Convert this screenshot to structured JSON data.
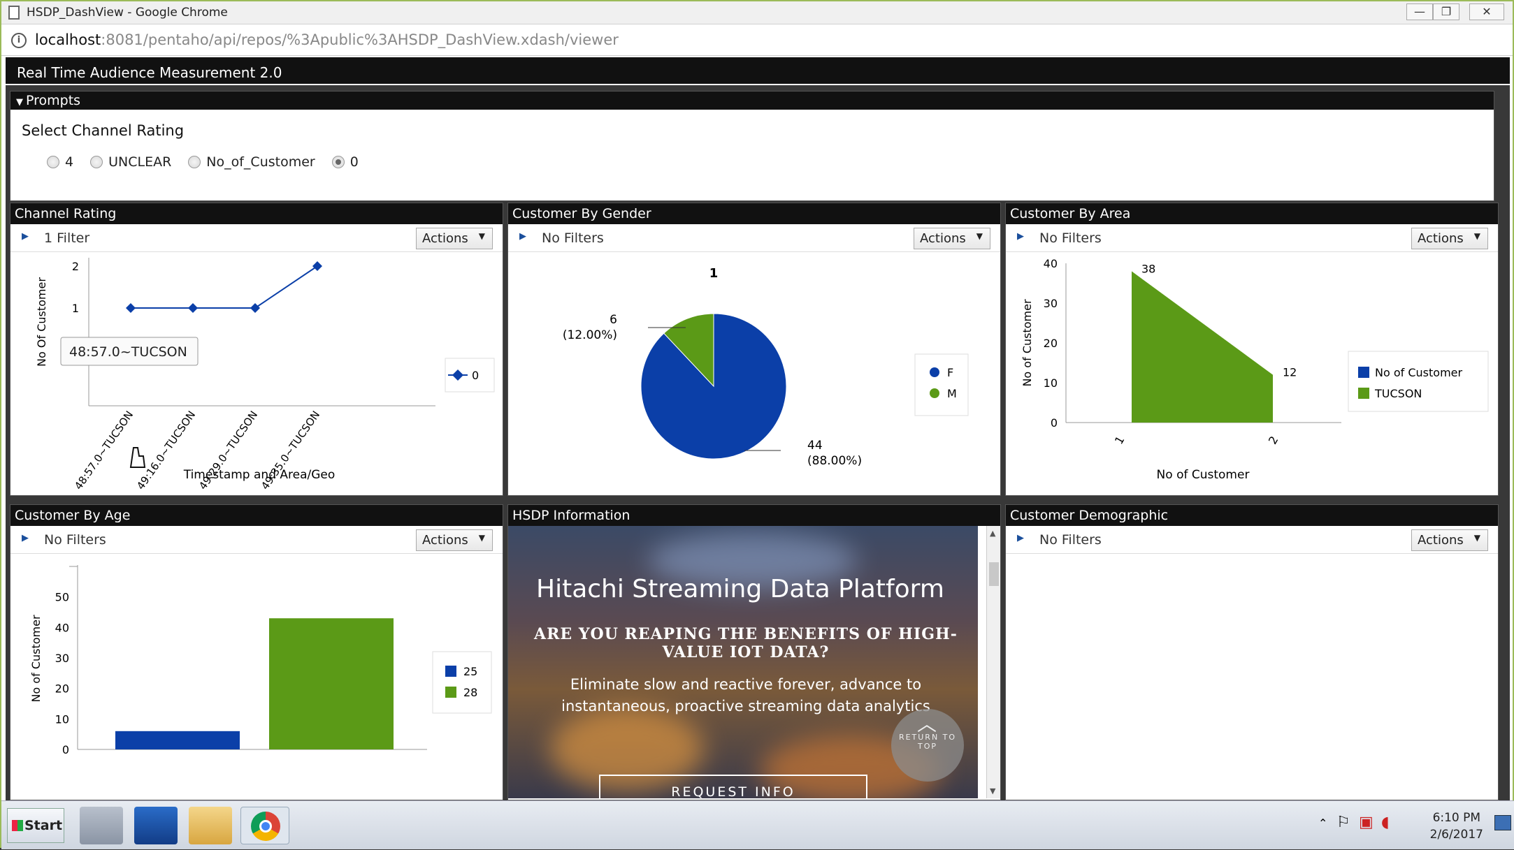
{
  "window": {
    "title": "HSDP_DashView - Google Chrome",
    "min_label": "—",
    "max_label": "❐",
    "close_label": "✕"
  },
  "address": {
    "host": "localhost",
    "path": ":8081/pentaho/api/repos/%3Apublic%3AHSDP_DashView.xdash/viewer"
  },
  "app": {
    "title": "Real Time Audience Measurement 2.0"
  },
  "prompts": {
    "header": "Prompts",
    "label": "Select Channel Rating",
    "options": [
      {
        "label": "4",
        "selected": false
      },
      {
        "label": "UNCLEAR",
        "selected": false
      },
      {
        "label": "No_of_Customer",
        "selected": false
      },
      {
        "label": "0",
        "selected": true
      }
    ]
  },
  "panels": {
    "channel_rating": {
      "title": "Channel Rating",
      "filter": "1 Filter",
      "actions": "Actions"
    },
    "gender": {
      "title": "Customer By Gender",
      "filter": "No Filters",
      "actions": "Actions"
    },
    "area": {
      "title": "Customer By Area",
      "filter": "No Filters",
      "actions": "Actions"
    },
    "age": {
      "title": "Customer By Age",
      "filter": "No Filters",
      "actions": "Actions"
    },
    "hsdp": {
      "title": "HSDP Information"
    },
    "demographic": {
      "title": "Customer Demographic",
      "filter": "No Filters",
      "actions": "Actions"
    }
  },
  "hsdp_info": {
    "heading": "Hitachi Streaming Data Platform",
    "subheading_line1": "ARE YOU REAPING THE BENEFITS OF HIGH-",
    "subheading_line2": "VALUE IOT DATA?",
    "body_line1": "Eliminate slow and reactive forever, advance to",
    "body_line2": "instantaneous, proactive streaming data analytics",
    "return_line1": "RETURN TO",
    "return_line2": "TOP",
    "request_button": "REQUEST INFO"
  },
  "colors": {
    "blue": "#0b3fa8",
    "green": "#5b9a17"
  },
  "chart_data": [
    {
      "type": "line",
      "x": [
        "48:57.0~TUCSON",
        "49:16.0~TUCSON",
        "49:29.0~TUCSON",
        "49:35.0~TUCSON"
      ],
      "series": [
        {
          "name": "0",
          "values": [
            1,
            1,
            1,
            2
          ]
        }
      ],
      "xlabel": "Timestamp and Area/Geo",
      "ylabel": "No Of Customer",
      "yticks": [
        "1",
        "2"
      ],
      "tooltip": "48:57.0~TUCSON",
      "legend": "right"
    },
    {
      "type": "pie",
      "title": "1",
      "slices": [
        {
          "name": "F",
          "value": 44,
          "label": "44",
          "pct": "(88.00%)"
        },
        {
          "name": "M",
          "value": 6,
          "label": "6",
          "pct": "(12.00%)"
        }
      ],
      "legend": "right"
    },
    {
      "type": "area",
      "x": [
        "1",
        "2"
      ],
      "series": [
        {
          "name": "TUCSON",
          "values": [
            38,
            12
          ]
        }
      ],
      "legend_entries": [
        "No of Customer",
        "TUCSON"
      ],
      "xlabel": "No of Customer",
      "ylabel": "No of Customer",
      "ylim": [
        0,
        40
      ],
      "yticks": [
        "0",
        "10",
        "20",
        "30",
        "40"
      ],
      "legend": "right"
    },
    {
      "type": "bar",
      "series": [
        {
          "name": "25",
          "values": [
            6
          ]
        },
        {
          "name": "28",
          "values": [
            43
          ]
        }
      ],
      "ylabel": "No of Customer",
      "ylim": [
        0,
        60
      ],
      "yticks": [
        "0",
        "10",
        "20",
        "30",
        "40",
        "50"
      ],
      "legend": "right"
    }
  ],
  "taskbar": {
    "start": "Start",
    "time": "6:10 PM",
    "date": "2/6/2017"
  }
}
